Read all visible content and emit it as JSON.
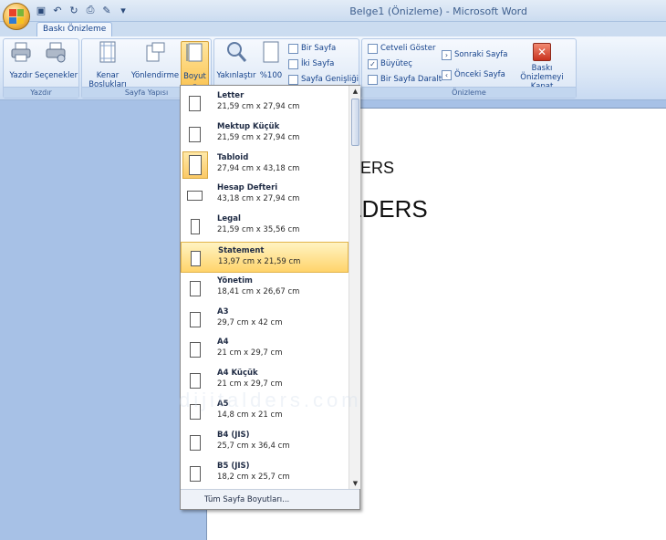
{
  "window": {
    "title": "Belge1 (Önizleme) - Microsoft Word"
  },
  "tabs": [
    {
      "label": "Baskı Önizleme"
    }
  ],
  "ribbon": {
    "groups": {
      "print": {
        "label": "Yazdır",
        "buttons": [
          "Yazdır",
          "Seçenekler"
        ]
      },
      "page_setup": {
        "label": "Sayfa Yapısı",
        "margins": "Kenar Boşlukları",
        "orientation": "Yönlendirme",
        "size": "Boyut"
      },
      "zoom": {
        "zoom": "Yakınlaştır",
        "hundred": "%100",
        "one_page": "Bir Sayfa",
        "two_pages": "İki Sayfa",
        "page_width": "Sayfa Genişliği"
      },
      "preview": {
        "label": "Önizleme",
        "show_ruler": "Cetveli Göster",
        "magnifier": "Büyüteç",
        "shrink": "Bir Sayfa Daralt",
        "next": "Sonraki Sayfa",
        "prev": "Önceki Sayfa",
        "close": "Baskı Önizlemeyi Kapat"
      }
    }
  },
  "document": {
    "line1": "DERS",
    "line2": "LDERS",
    "watermark": "dijitalders.com"
  },
  "paper_sizes": [
    {
      "name": "Letter",
      "dims": "21,59 cm x 27,94 cm",
      "ratio": 0.77
    },
    {
      "name": "Mektup Küçük",
      "dims": "21,59 cm x 27,94 cm",
      "ratio": 0.77
    },
    {
      "name": "Tabloid",
      "dims": "27,94 cm x 43,18 cm",
      "ratio": 0.65
    },
    {
      "name": "Hesap Defteri",
      "dims": "43,18 cm x 27,94 cm",
      "ratio": 1.55
    },
    {
      "name": "Legal",
      "dims": "21,59 cm x 35,56 cm",
      "ratio": 0.61
    },
    {
      "name": "Statement",
      "dims": "13,97 cm x 21,59 cm",
      "ratio": 0.65
    },
    {
      "name": "Yönetim",
      "dims": "18,41 cm x 26,67 cm",
      "ratio": 0.69
    },
    {
      "name": "A3",
      "dims": "29,7 cm x 42 cm",
      "ratio": 0.71
    },
    {
      "name": "A4",
      "dims": "21 cm x 29,7 cm",
      "ratio": 0.71
    },
    {
      "name": "A4 Küçük",
      "dims": "21 cm x 29,7 cm",
      "ratio": 0.71
    },
    {
      "name": "A5",
      "dims": "14,8 cm x 21 cm",
      "ratio": 0.7
    },
    {
      "name": "B4 (JIS)",
      "dims": "25,7 cm x 36,4 cm",
      "ratio": 0.71
    },
    {
      "name": "B5 (JIS)",
      "dims": "18,2 cm x 25,7 cm",
      "ratio": 0.71
    }
  ],
  "selected_index": 2,
  "hover_index": 5,
  "footer": {
    "label": "Tüm Sayfa Boyutları..."
  },
  "colors": {
    "accent": "#fbc658",
    "ribbon_text": "#15428b",
    "hover": "#ffd46b"
  }
}
